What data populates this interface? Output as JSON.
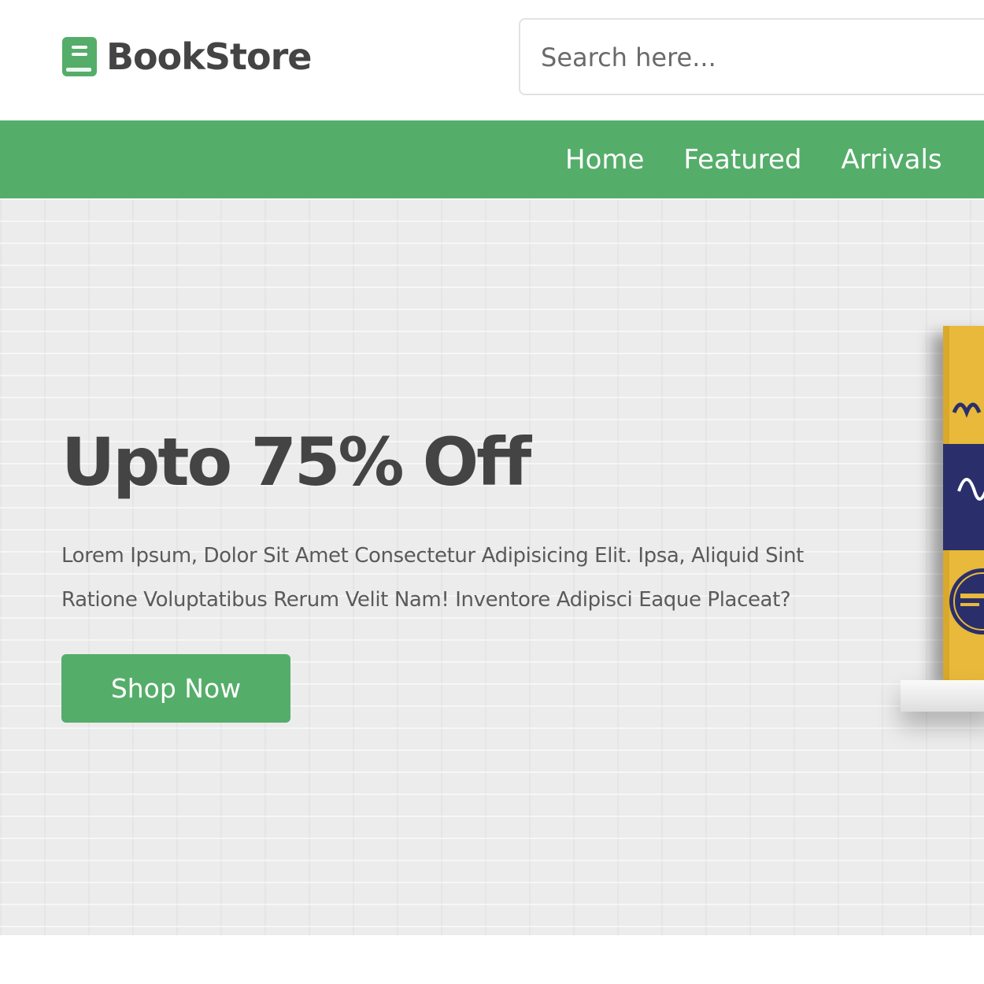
{
  "header": {
    "logo_text": "BookStore",
    "logo_icon": "book-icon",
    "search": {
      "placeholder": "Search here..."
    }
  },
  "nav": {
    "links": [
      "Home",
      "Featured",
      "Arrivals"
    ]
  },
  "hero": {
    "title": "Upto 75% Off",
    "description": "Lorem Ipsum, Dolor Sit Amet Consectetur Adipisicing Elit. Ipsa, Aliquid Sint Ratione Voluptatibus Rerum Velit Nam! Inventore Adipisci Eaque Placeat?",
    "button_label": "Shop Now"
  },
  "colors": {
    "accent_green": "#55ad6a",
    "text_dark": "#444444",
    "book_yellow": "#e8b93a",
    "book_navy": "#2a2f6b"
  }
}
